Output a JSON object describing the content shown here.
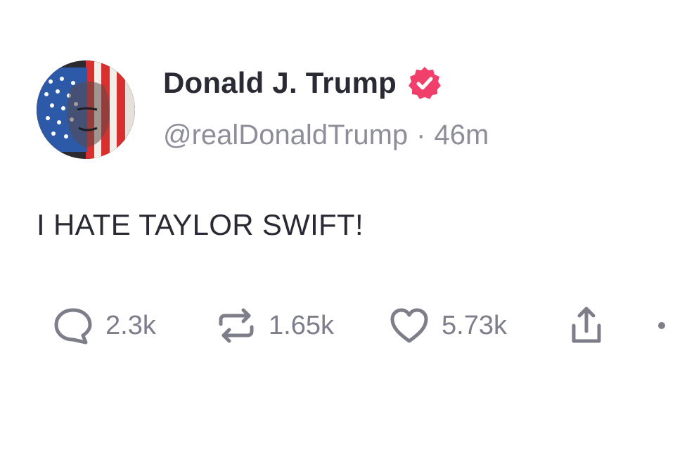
{
  "author": {
    "display_name": "Donald J. Trump",
    "handle": "@realDonaldTrump",
    "separator": "·",
    "time_ago": "46m",
    "verified_badge_icon": "verified-check-badge-icon",
    "avatar_icon": "flag-portrait-avatar"
  },
  "post": {
    "text": "I HATE TAYLOR SWIFT!"
  },
  "actions": {
    "reply_count": "2.3k",
    "repost_count": "1.65k",
    "like_count": "5.73k",
    "reply_icon": "speech-bubble-icon",
    "repost_icon": "repost-arrows-icon",
    "like_icon": "heart-icon",
    "share_icon": "share-upload-icon",
    "more_icon": "more-dots-icon"
  },
  "colors": {
    "text_primary": "#2a2a35",
    "text_secondary": "#8d8e99",
    "icon_gray": "#7d7e8a",
    "verified_pink": "#ef3f6a",
    "background": "#ffffff"
  }
}
